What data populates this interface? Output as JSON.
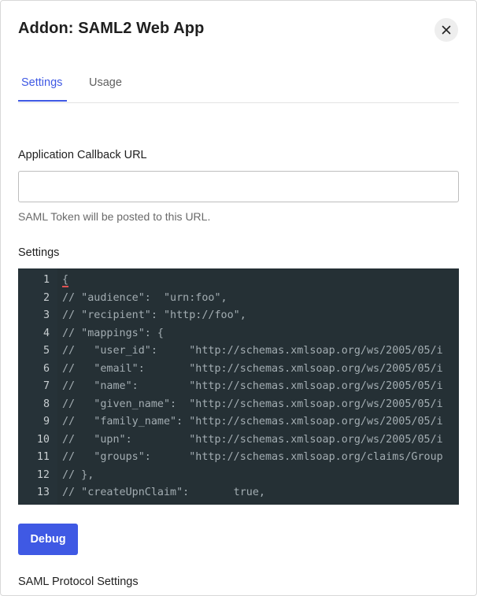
{
  "dialog": {
    "title": "Addon: SAML2 Web App",
    "close_icon": "close-icon"
  },
  "tabs": [
    {
      "label": "Settings",
      "active": true
    },
    {
      "label": "Usage",
      "active": false
    }
  ],
  "callback": {
    "label": "Application Callback URL",
    "value": "",
    "placeholder": "",
    "help": "SAML Token will be posted to this URL."
  },
  "settings": {
    "label": "Settings",
    "lines": [
      {
        "n": "1",
        "text": "{"
      },
      {
        "n": "2",
        "text": "// \"audience\":  \"urn:foo\","
      },
      {
        "n": "3",
        "text": "// \"recipient\": \"http://foo\","
      },
      {
        "n": "4",
        "text": "// \"mappings\": {"
      },
      {
        "n": "5",
        "text": "//   \"user_id\":     \"http://schemas.xmlsoap.org/ws/2005/05/i"
      },
      {
        "n": "6",
        "text": "//   \"email\":       \"http://schemas.xmlsoap.org/ws/2005/05/i"
      },
      {
        "n": "7",
        "text": "//   \"name\":        \"http://schemas.xmlsoap.org/ws/2005/05/i"
      },
      {
        "n": "8",
        "text": "//   \"given_name\":  \"http://schemas.xmlsoap.org/ws/2005/05/i"
      },
      {
        "n": "9",
        "text": "//   \"family_name\": \"http://schemas.xmlsoap.org/ws/2005/05/i"
      },
      {
        "n": "10",
        "text": "//   \"upn\":         \"http://schemas.xmlsoap.org/ws/2005/05/i"
      },
      {
        "n": "11",
        "text": "//   \"groups\":      \"http://schemas.xmlsoap.org/claims/Group"
      },
      {
        "n": "12",
        "text": "// },"
      },
      {
        "n": "13",
        "text": "// \"createUpnClaim\":       true,"
      }
    ]
  },
  "debug": {
    "label": "Debug"
  },
  "protocol": {
    "label": "SAML Protocol Settings"
  },
  "colors": {
    "accent": "#3f59e4",
    "editor_bg": "#253035",
    "code_text": "#a3adb2"
  }
}
